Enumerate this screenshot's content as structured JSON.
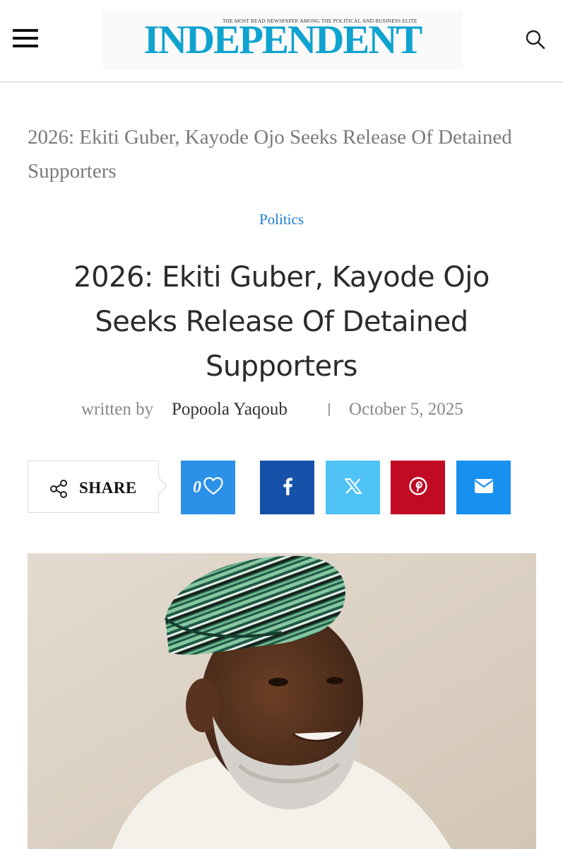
{
  "header": {
    "tagline": "THE MOST READ NEWSPAPER AMONG THE POLITICAL AND BUSINESS ELITE",
    "logo_text": "INDEPENDENT",
    "menu_icon": "hamburger-menu-icon",
    "search_icon": "search-icon",
    "brand_color": "#0fa3cf"
  },
  "article": {
    "breadcrumb_title": "2026: Ekiti Guber, Kayode Ojo Seeks Release Of Detained Supporters",
    "category": "Politics",
    "headline": "2026: Ekiti Guber, Kayode Ojo Seeks Release Of Detained Supporters",
    "byline_prefix": "written by",
    "author": "Popoola Yaqoub",
    "date": "October 5, 2025"
  },
  "share": {
    "label": "SHARE",
    "like_count": "0",
    "buttons": [
      {
        "name": "like",
        "icon": "heart-icon",
        "color": "#2b90e8"
      },
      {
        "name": "facebook",
        "icon": "facebook-icon",
        "color": "#1551a8"
      },
      {
        "name": "x",
        "icon": "x-icon",
        "color": "#4fc3f5"
      },
      {
        "name": "pinterest",
        "icon": "pinterest-icon",
        "color": "#c10a23"
      },
      {
        "name": "email",
        "icon": "envelope-icon",
        "color": "#1890f0"
      }
    ]
  },
  "hero_image": {
    "subject": "portrait-photo"
  }
}
